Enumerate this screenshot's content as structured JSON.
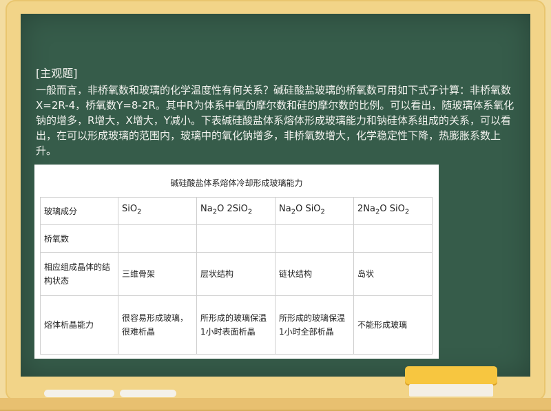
{
  "question": {
    "tag": "[主观题]",
    "text": "一般而言，非桥氧数和玻璃的化学温度性有何关系？碱硅酸盐玻璃的桥氧数可用如下式子计算：非桥氧数X=2R-4，桥氧数Y=8-2R。其中R为体系中氧的摩尔数和硅的摩尔数的比例。可以看出，随玻璃体系氧化钠的增多，R增大，X增大，Y减小。下表碱硅酸盐体系熔体形成玻璃能力和钠硅体系组成的关系，可以看出，在可以形成玻璃的范围内，玻璃中的氧化钠增多，非桥氧数增大，化学稳定性下降，热膨胀系数上升。"
  },
  "table": {
    "title": "碱硅酸盐体系熔体冷却形成玻璃能力",
    "header_label": "玻璃成分",
    "compositions": [
      {
        "parts": [
          "SiO",
          "2",
          ""
        ]
      },
      {
        "parts": [
          "Na",
          "2",
          "O 2SiO",
          "2",
          ""
        ]
      },
      {
        "parts": [
          "Na",
          "2",
          "O SiO",
          "2",
          ""
        ]
      },
      {
        "parts": [
          "2Na",
          "2",
          "O SiO",
          "2",
          ""
        ]
      }
    ],
    "row_bridge_label": "桥氧数",
    "row_bridge_values": [
      "",
      "",
      "",
      ""
    ],
    "row_structure_label": "相应组成晶体的结构状态",
    "row_structure_values": [
      "三维骨架",
      "层状结构",
      "链状结构",
      "岛状"
    ],
    "row_ability_label": "熔体析晶能力",
    "row_ability_values": [
      "很容易形成玻璃，很难析晶",
      "所形成的玻璃保温1小时表面析晶",
      "所形成的玻璃保温1小时全部析晶",
      "不能形成玻璃"
    ]
  }
}
